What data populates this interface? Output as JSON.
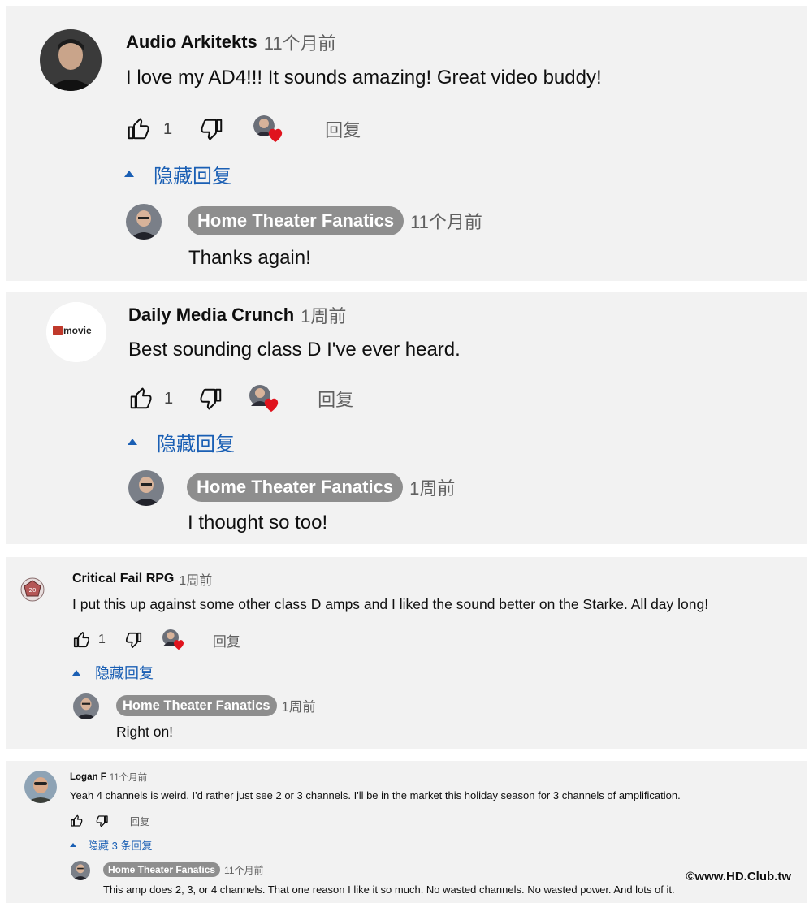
{
  "threads": [
    {
      "author": "Audio Arkitekts",
      "time": "11个月前",
      "text": "I love my AD4!!! It sounds amazing! Great video buddy!",
      "likes": "1",
      "reply_label": "回复",
      "hide_label": "隐藏回复",
      "reply": {
        "author": "Home Theater Fanatics",
        "time": "11个月前",
        "text": "Thanks again!"
      }
    },
    {
      "author": "Daily Media Crunch",
      "time": "1周前",
      "text": "Best sounding class D I've ever heard.",
      "likes": "1",
      "reply_label": "回复",
      "hide_label": "隐藏回复",
      "logo_text": "movie",
      "reply": {
        "author": "Home Theater Fanatics",
        "time": "1周前",
        "text": "I thought so too!"
      }
    },
    {
      "author": "Critical Fail RPG",
      "time": "1周前",
      "text": "I put this up against some other class D amps and I liked the sound better on the Starke. All day long!",
      "likes": "1",
      "reply_label": "回复",
      "hide_label": "隐藏回复",
      "reply": {
        "author": "Home Theater Fanatics",
        "time": "1周前",
        "text": "Right on!"
      }
    },
    {
      "author": "Logan F",
      "time": "11个月前",
      "text": "Yeah 4 channels is weird.  I'd rather just see 2 or 3 channels.  I'll be in the market this holiday season for 3 channels of amplification.",
      "likes": "",
      "reply_label": "回复",
      "hide_label": "隐藏 3 条回复",
      "reply": {
        "author": "Home Theater Fanatics",
        "time": "11个月前",
        "text": "This amp does 2, 3, or 4 channels. That one reason I like it so much. No wasted channels. No wasted power. And lots of it."
      }
    }
  ],
  "watermark": "©www.HD.Club.tw",
  "colors": {
    "panel": "#f2f2f2",
    "link_blue": "#1a5fb4",
    "chip": "#8e8e8e",
    "heart": "#e0131d"
  }
}
